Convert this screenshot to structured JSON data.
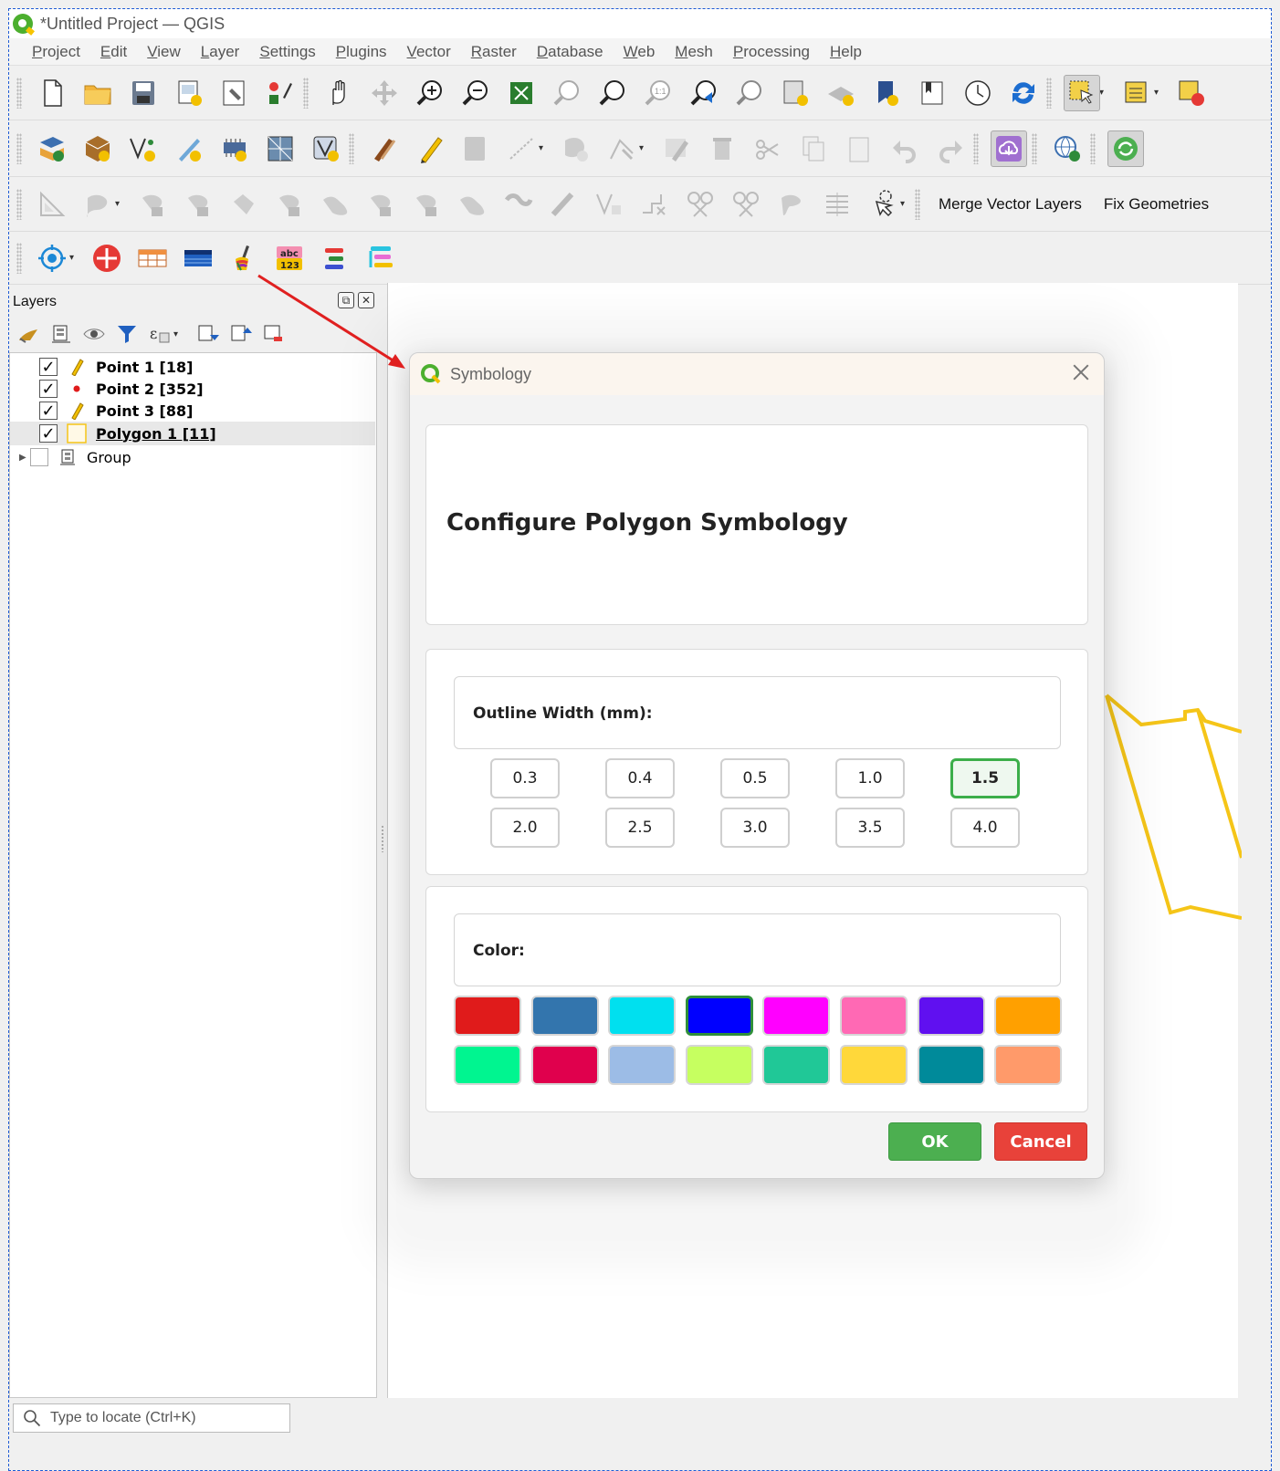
{
  "window": {
    "title": "*Untitled Project — QGIS"
  },
  "menubar": {
    "items": [
      "Project",
      "Edit",
      "View",
      "Layer",
      "Settings",
      "Plugins",
      "Vector",
      "Raster",
      "Database",
      "Web",
      "Mesh",
      "Processing",
      "Help"
    ]
  },
  "toolbar3": {
    "merge_label": "Merge Vector Layers",
    "fix_label": "Fix Geometries"
  },
  "layers_panel": {
    "title": "Layers",
    "layers": [
      {
        "label": "Point 1 [18]",
        "checked": true
      },
      {
        "label": "Point 2 [352]",
        "checked": true
      },
      {
        "label": "Point 3 [88]",
        "checked": true
      },
      {
        "label": "Polygon 1 [11]",
        "checked": true,
        "selected": true
      },
      {
        "label": "Group",
        "checked": false,
        "group": true
      }
    ]
  },
  "statusbar": {
    "locator_placeholder": "Type to locate (Ctrl+K)"
  },
  "dialog": {
    "title": "Symbology",
    "heading": "Configure Polygon Symbology",
    "width_label": "Outline Width (mm):",
    "width_options": [
      "0.3",
      "0.4",
      "0.5",
      "1.0",
      "1.5",
      "2.0",
      "2.5",
      "3.0",
      "3.5",
      "4.0"
    ],
    "width_selected": "1.5",
    "color_label": "Color:",
    "colors": [
      "#e01b1b",
      "#3375ad",
      "#00e0ef",
      "#0000ff",
      "#ff00ff",
      "#ff69b4",
      "#6010f0",
      "#ffa000",
      "#00f590",
      "#e0004d",
      "#9cbce6",
      "#c6ff60",
      "#20c897",
      "#ffd83a",
      "#008a9a",
      "#ff9a6a"
    ],
    "color_selected_index": 3,
    "ok_label": "OK",
    "cancel_label": "Cancel"
  },
  "accent_colors": {
    "ok": "#4caf50",
    "cancel": "#e8423a",
    "selected": "#3cae4a",
    "polygon_outline": "#f5c518",
    "arrow": "#e02020"
  }
}
